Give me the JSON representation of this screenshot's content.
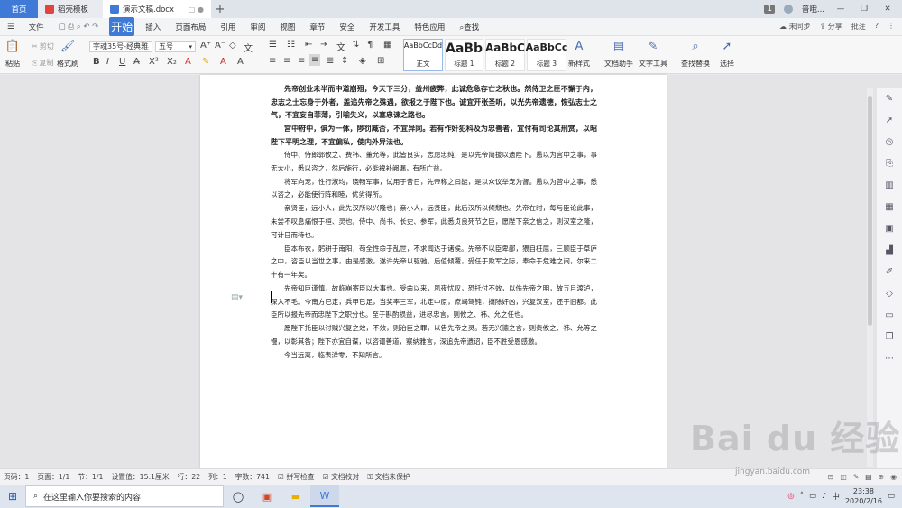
{
  "tabs": {
    "home": "首页",
    "template": "稻壳模板",
    "doc": "演示文稿.docx",
    "page_count": "1",
    "user": "普哦..."
  },
  "menu": {
    "file": "文件",
    "items": [
      "开始",
      "插入",
      "页面布局",
      "引用",
      "审阅",
      "视图",
      "章节",
      "安全",
      "开发工具",
      "特色应用"
    ],
    "search": "查找",
    "sync": "未同步",
    "share": "分享",
    "comment": "批注"
  },
  "ribbon": {
    "paste": "粘贴",
    "cut": "剪切",
    "copy": "复制",
    "format_painter": "格式刷",
    "font_name": "字魂35号-经典雅黑",
    "font_size": "五号",
    "styles": [
      {
        "preview": "AaBbCcDd",
        "name": "正文"
      },
      {
        "preview": "AaBb",
        "name": "标题 1"
      },
      {
        "preview": "AaBbC",
        "name": "标题 2"
      },
      {
        "preview": "AaBbCc",
        "name": "标题 3"
      }
    ],
    "new_style": "新样式",
    "doc_assistant": "文档助手",
    "text_tools": "文字工具",
    "find_replace": "查找替换",
    "select": "选择"
  },
  "document": {
    "paragraphs": [
      {
        "bold": true,
        "text": "先帝创业未半而中道崩殂，今天下三分，益州疲弊，此诚危急存亡之秋也。然侍卫之臣不懈于内，忠志之士忘身于外者，盖追先帝之殊遇，欲报之于陛下也。诚宜开张圣听，以光先帝遗德，恢弘志士之气，不宜妄自菲薄，引喻失义，以塞忠谏之路也。"
      },
      {
        "bold": true,
        "text": "宫中府中，俱为一体，陟罚臧否，不宜异同。若有作奸犯科及为忠善者，宜付有司论其刑赏，以昭陛下平明之理，不宜偏私，使内外异法也。"
      },
      {
        "bold": false,
        "text": "侍中、侍郎郭攸之、费祎、董允等，此皆良实，志虑忠纯，是以先帝简拔以遗陛下。愚以为宫中之事，事无大小，悉以咨之，然后施行，必能裨补阙漏，有所广益。"
      },
      {
        "bold": false,
        "text": "将军向宠，性行淑均，晓畅军事，试用于昔日，先帝称之曰能，是以众议举宠为督。愚以为营中之事，悉以咨之，必能使行阵和睦，优劣得所。"
      },
      {
        "bold": false,
        "text": "亲贤臣，远小人，此先汉所以兴隆也；亲小人，远贤臣，此后汉所以倾颓也。先帝在时，每与臣论此事，未尝不叹息痛恨于桓、灵也。侍中、尚书、长史、参军，此悉贞良死节之臣，愿陛下亲之信之，则汉室之隆，可计日而待也。"
      },
      {
        "bold": false,
        "text": "臣本布衣，躬耕于南阳，苟全性命于乱世，不求闻达于诸侯。先帝不以臣卑鄙，猥自枉屈，三顾臣于草庐之中，咨臣以当世之事，由是感激，遂许先帝以驱驰。后值倾覆，受任于败军之际，奉命于危难之间，尔来二十有一年矣。"
      },
      {
        "bold": false,
        "text": "先帝知臣谨慎，故临崩寄臣以大事也。受命以来，夙夜忧叹，恐托付不效，以伤先帝之明，故五月渡泸，深入不毛。今南方已定，兵甲已足，当奖率三军，北定中原，庶竭驽钝，攘除奸凶，兴复汉室，还于旧都。此臣所以报先帝而忠陛下之职分也。至于斟酌损益，进尽忠言，则攸之、祎、允之任也。"
      },
      {
        "bold": false,
        "text": "愿陛下托臣以讨贼兴复之效，不效，则治臣之罪，以告先帝之灵。若无兴德之言，则责攸之、祎、允等之慢，以彰其咎；陛下亦宜自谋，以咨诹善道，察纳雅言，深追先帝遗诏，臣不胜受恩感激。"
      },
      {
        "bold": false,
        "text": "今当远离，临表涕零，不知所言。"
      }
    ]
  },
  "status": {
    "page_num": "页码：1",
    "page": "页面：1/1",
    "section": "节：1/1",
    "setting": "设置值：15.1厘米",
    "row": "行：22",
    "col": "列：1",
    "words": "字数：741",
    "spell": "拼写检查",
    "proof": "文档校对",
    "unprotected": "文档未保护"
  },
  "taskbar": {
    "search_placeholder": "在这里输入你要搜索的内容",
    "time": "23:38",
    "date": "2020/2/16",
    "ime": "中"
  },
  "watermark": {
    "text": "Bai du 经验",
    "url": "jingyan.baidu.com"
  },
  "colors": {
    "accent": "#3e7ad6",
    "ribbon_bg": "#f7f7f8",
    "page_bg": "#ffffff"
  }
}
